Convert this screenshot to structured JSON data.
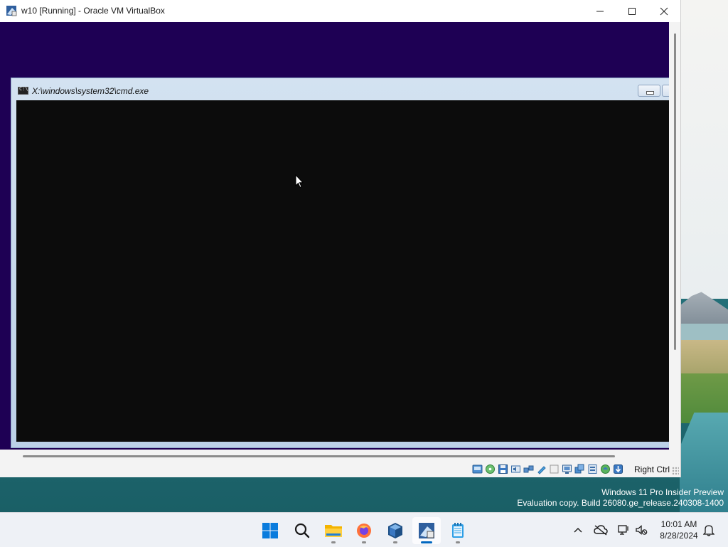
{
  "vbox": {
    "title": "w10 [Running] - Oracle VM VirtualBox",
    "host_key_label": "Right Ctrl",
    "status_icons": [
      "hard-disk-icon",
      "optical-drive-icon",
      "floppy-icon",
      "audio-icon",
      "network-icon",
      "usb-icon",
      "shared-folders-icon",
      "display-icon",
      "video-capture-icon",
      "recording-icon",
      "cpu-icon",
      "mouse-integration-icon",
      "keyboard-icon"
    ]
  },
  "cmd": {
    "title": "X:\\windows\\system32\\cmd.exe"
  },
  "desktop": {
    "watermark_line1": "Windows 11 Pro Insider Preview",
    "watermark_line2": "Evaluation copy. Build 26080.ge_release.240308-1400"
  },
  "taskbar": {
    "apps": [
      "start-icon",
      "search-icon",
      "file-explorer-icon",
      "firefox-icon",
      "virtualbox-icon",
      "virtualbox-manager-icon",
      "notepad-icon"
    ],
    "time": "10:01 AM",
    "date": "8/28/2024"
  },
  "colors": {
    "vm_background": "#1e0054",
    "console_background": "#0c0c0c",
    "accent": "#0067c0"
  }
}
